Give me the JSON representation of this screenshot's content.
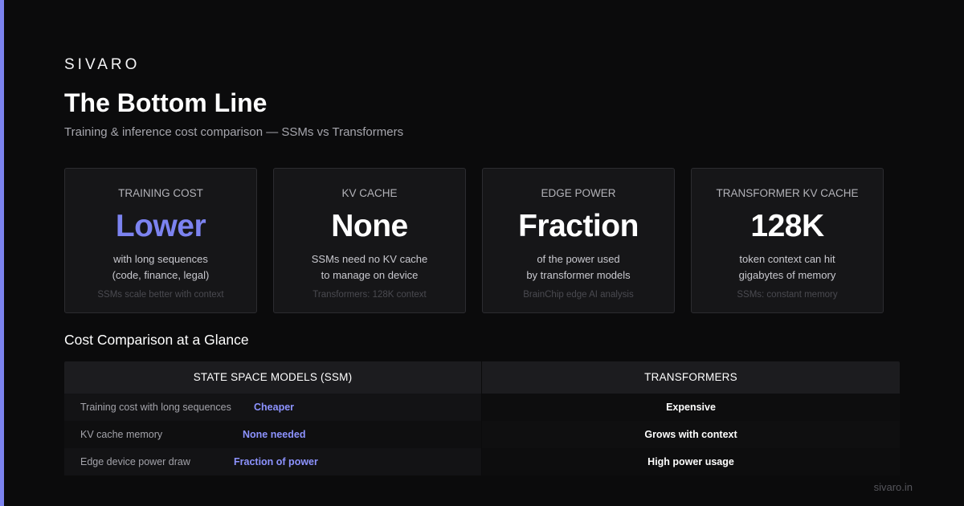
{
  "brand": "SIVARO",
  "title": "The Bottom Line",
  "subtitle": "Training & inference cost comparison — SSMs vs Transformers",
  "colors": {
    "accent": "#7c83f0",
    "background": "#0b0b0c",
    "card": "#161618"
  },
  "cards": [
    {
      "label": "TRAINING COST",
      "value": "Lower",
      "desc1": "with long sequences",
      "desc2": "(code, finance, legal)",
      "note": "SSMs scale better with context"
    },
    {
      "label": "KV CACHE",
      "value": "None",
      "desc1": "SSMs need no KV cache",
      "desc2": "to manage on device",
      "note": "Transformers: 128K context"
    },
    {
      "label": "EDGE POWER",
      "value": "Fraction",
      "desc1": "of the power used",
      "desc2": "by transformer models",
      "note": "BrainChip edge AI analysis"
    },
    {
      "label": "TRANSFORMER KV CACHE",
      "value": "128K",
      "desc1": "token context can hit",
      "desc2": "gigabytes of memory",
      "note": "SSMs: constant memory"
    }
  ],
  "comparison": {
    "title": "Cost Comparison at a Glance",
    "headers": [
      "STATE SPACE MODELS (SSM)",
      "TRANSFORMERS"
    ],
    "rows": [
      {
        "feature": "Training cost with long sequences",
        "ssm": "Cheaper",
        "transformer": "Expensive"
      },
      {
        "feature": "KV cache memory",
        "ssm": "None needed",
        "transformer": "Grows with context"
      },
      {
        "feature": "Edge device power draw",
        "ssm": "Fraction of power",
        "transformer": "High power usage"
      }
    ]
  },
  "footer": "sivaro.in"
}
